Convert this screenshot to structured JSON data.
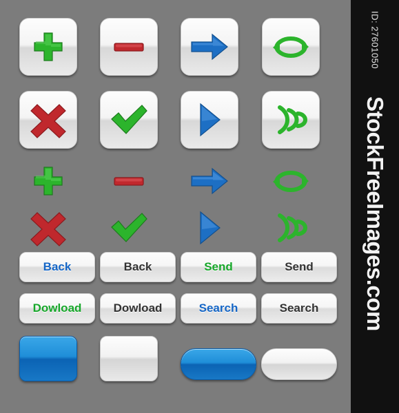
{
  "watermark": {
    "id_label": "ID: 27601050",
    "site_text": "StockFreeImages.com"
  },
  "colors": {
    "background": "#7c7c7c",
    "green": "#2cb42c",
    "red": "#c0282d",
    "blue": "#1d6fc4",
    "button_face": "#f2f2f2",
    "watermark_bar": "#111111"
  },
  "icon_buttons": {
    "row1": [
      {
        "icon": "plus-icon",
        "color": "#2cb42c"
      },
      {
        "icon": "minus-icon",
        "color": "#c0282d"
      },
      {
        "icon": "arrow-right-icon",
        "color": "#1d6fc4"
      },
      {
        "icon": "refresh-icon",
        "color": "#2cb42c"
      }
    ],
    "row2": [
      {
        "icon": "close-x-icon",
        "color": "#c0282d"
      },
      {
        "icon": "check-icon",
        "color": "#2cb42c"
      },
      {
        "icon": "play-icon",
        "color": "#1d6fc4"
      },
      {
        "icon": "wifi-signal-icon",
        "color": "#2cb42c"
      }
    ],
    "row3": [
      {
        "icon": "plus-icon",
        "color": "#2cb42c"
      },
      {
        "icon": "minus-icon",
        "color": "#c0282d"
      },
      {
        "icon": "arrow-right-icon",
        "color": "#1d6fc4"
      },
      {
        "icon": "refresh-icon",
        "color": "#2cb42c"
      }
    ],
    "row4": [
      {
        "icon": "close-x-icon",
        "color": "#c0282d"
      },
      {
        "icon": "check-icon",
        "color": "#2cb42c"
      },
      {
        "icon": "play-icon",
        "color": "#1d6fc4"
      },
      {
        "icon": "wifi-signal-icon",
        "color": "#2cb42c"
      }
    ]
  },
  "text_buttons": {
    "row5": [
      {
        "label": "Back",
        "style": "blue"
      },
      {
        "label": "Back",
        "style": "dark"
      },
      {
        "label": "Send",
        "style": "green"
      },
      {
        "label": "Send",
        "style": "dark"
      }
    ],
    "row6": [
      {
        "label": "Dowload",
        "style": "green"
      },
      {
        "label": "Dowload",
        "style": "dark"
      },
      {
        "label": "Search",
        "style": "blue"
      },
      {
        "label": "Search",
        "style": "dark"
      }
    ]
  },
  "blank_buttons": [
    {
      "name": "blank-square-blue",
      "shape": "square",
      "color": "#1d7fc8"
    },
    {
      "name": "blank-square-grey",
      "shape": "square",
      "color": "#e6e6e6"
    },
    {
      "name": "blank-rounded-blue",
      "shape": "rounded",
      "color": "#1d7fc8"
    },
    {
      "name": "blank-rounded-grey",
      "shape": "rounded",
      "color": "#e6e6e6"
    }
  ]
}
